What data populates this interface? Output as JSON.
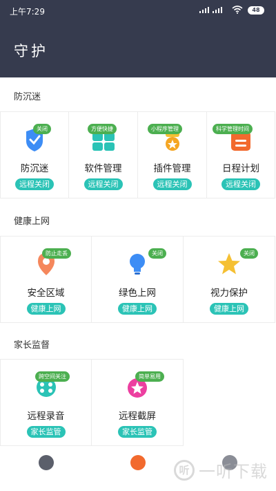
{
  "status_bar": {
    "time": "上午7:29",
    "battery": "48"
  },
  "page_title": "守护",
  "sections": [
    {
      "title": "防沉迷",
      "items": [
        {
          "label": "防沉迷",
          "tag": "关闭",
          "button": "远程关闭",
          "icon": "shield-icon"
        },
        {
          "label": "软件管理",
          "tag": "方便快捷",
          "button": "远程关闭",
          "icon": "apps-grid-icon"
        },
        {
          "label": "插件管理",
          "tag": "小程序管理",
          "button": "远程关闭",
          "icon": "plugin-icon"
        },
        {
          "label": "日程计划",
          "tag": "科学管理时间",
          "button": "远程关闭",
          "icon": "calendar-icon"
        }
      ]
    },
    {
      "title": "健康上网",
      "items": [
        {
          "label": "安全区域",
          "tag": "防止走丢",
          "button": "健康上网",
          "icon": "location-pin-icon"
        },
        {
          "label": "绿色上网",
          "tag": "关闭",
          "button": "健康上网",
          "icon": "lightbulb-icon"
        },
        {
          "label": "视力保护",
          "tag": "关闭",
          "button": "健康上网",
          "icon": "star-icon"
        }
      ]
    },
    {
      "title": "家长监督",
      "items": [
        {
          "label": "远程录音",
          "tag": "跨空间关注",
          "button": "家长监管",
          "icon": "film-reel-icon"
        },
        {
          "label": "远程截屏",
          "tag": "简单易用",
          "button": "家长监管",
          "icon": "screenshot-icon"
        }
      ]
    }
  ],
  "tabbar": {
    "icons": [
      "home-tab-icon",
      "guard-tab-icon",
      "apps-tab-icon"
    ]
  },
  "watermark": "一听下载",
  "colors": {
    "header_bg": "#363b4e",
    "tag_green": "#4caf50",
    "pill_teal": "#2bc3b6"
  }
}
